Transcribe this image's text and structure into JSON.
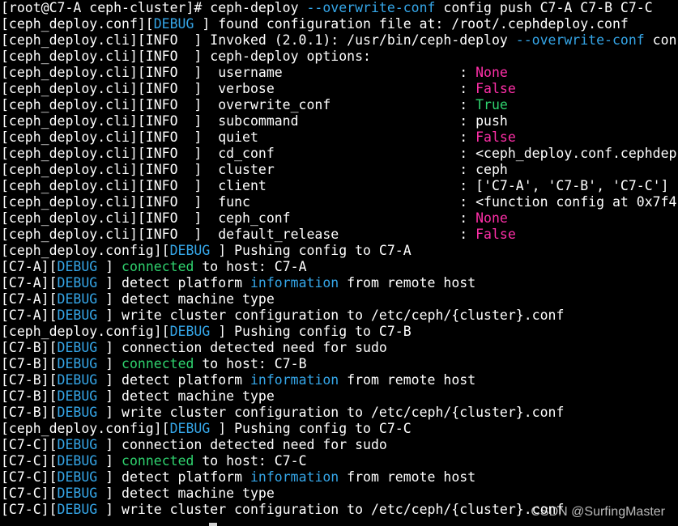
{
  "colors": {
    "default": "#ffffff",
    "debug": "#35a6e8",
    "info": "#ffffff",
    "option": "#35a6e8",
    "connected": "#2fd26e",
    "information": "#35a6e8",
    "none": "#ff2fa8",
    "false": "#ff2fa8",
    "true": "#2fd26e"
  },
  "terminal": {
    "lines": [
      [
        {
          "t": "[root@C7-A ceph-cluster]# ceph-deploy "
        },
        {
          "t": "--overwrite-conf",
          "c": "option"
        },
        {
          "t": " config push C7-A C7-B C7-C"
        }
      ],
      [
        {
          "t": "[ceph_deploy.conf]["
        },
        {
          "t": "DEBUG",
          "c": "debug"
        },
        {
          "t": " ] found configuration file at: /root/.cephdeploy.conf"
        }
      ],
      [
        {
          "t": "[ceph_deploy.cli][INFO  ] Invoked (2.0.1): /usr/bin/ceph-deploy "
        },
        {
          "t": "--overwrite-conf",
          "c": "option"
        },
        {
          "t": " con"
        }
      ],
      [
        {
          "t": "[ceph_deploy.cli][INFO  ] ceph-deploy options:"
        }
      ],
      [
        {
          "t": "[ceph_deploy.cli][INFO  ]  username                      : "
        },
        {
          "t": "None",
          "c": "none"
        }
      ],
      [
        {
          "t": "[ceph_deploy.cli][INFO  ]  verbose                       : "
        },
        {
          "t": "False",
          "c": "false"
        }
      ],
      [
        {
          "t": "[ceph_deploy.cli][INFO  ]  overwrite_conf                : "
        },
        {
          "t": "True",
          "c": "true"
        }
      ],
      [
        {
          "t": "[ceph_deploy.cli][INFO  ]  subcommand                    : push"
        }
      ],
      [
        {
          "t": "[ceph_deploy.cli][INFO  ]  quiet                         : "
        },
        {
          "t": "False",
          "c": "false"
        }
      ],
      [
        {
          "t": "[ceph_deploy.cli][INFO  ]  cd_conf                       : <ceph_deploy.conf.cephdep"
        }
      ],
      [
        {
          "t": "[ceph_deploy.cli][INFO  ]  cluster                       : ceph"
        }
      ],
      [
        {
          "t": "[ceph_deploy.cli][INFO  ]  client                        : ['C7-A', 'C7-B', 'C7-C']"
        }
      ],
      [
        {
          "t": "[ceph_deploy.cli][INFO  ]  func                          : <function config at 0x7f4"
        }
      ],
      [
        {
          "t": "[ceph_deploy.cli][INFO  ]  ceph_conf                     : "
        },
        {
          "t": "None",
          "c": "none"
        }
      ],
      [
        {
          "t": "[ceph_deploy.cli][INFO  ]  default_release               : "
        },
        {
          "t": "False",
          "c": "false"
        }
      ],
      [
        {
          "t": "[ceph_deploy.config]["
        },
        {
          "t": "DEBUG",
          "c": "debug"
        },
        {
          "t": " ] Pushing config to C7-A"
        }
      ],
      [
        {
          "t": "[C7-A]["
        },
        {
          "t": "DEBUG",
          "c": "debug"
        },
        {
          "t": " ] "
        },
        {
          "t": "connected",
          "c": "connected"
        },
        {
          "t": " to host: C7-A"
        }
      ],
      [
        {
          "t": "[C7-A]["
        },
        {
          "t": "DEBUG",
          "c": "debug"
        },
        {
          "t": " ] detect platform "
        },
        {
          "t": "information",
          "c": "information"
        },
        {
          "t": " from remote host"
        }
      ],
      [
        {
          "t": "[C7-A]["
        },
        {
          "t": "DEBUG",
          "c": "debug"
        },
        {
          "t": " ] detect machine type"
        }
      ],
      [
        {
          "t": "[C7-A]["
        },
        {
          "t": "DEBUG",
          "c": "debug"
        },
        {
          "t": " ] write cluster configuration to /etc/ceph/{cluster}.conf"
        }
      ],
      [
        {
          "t": "[ceph_deploy.config]["
        },
        {
          "t": "DEBUG",
          "c": "debug"
        },
        {
          "t": " ] Pushing config to C7-B"
        }
      ],
      [
        {
          "t": "[C7-B]["
        },
        {
          "t": "DEBUG",
          "c": "debug"
        },
        {
          "t": " ] connection detected need for sudo"
        }
      ],
      [
        {
          "t": "[C7-B]["
        },
        {
          "t": "DEBUG",
          "c": "debug"
        },
        {
          "t": " ] "
        },
        {
          "t": "connected",
          "c": "connected"
        },
        {
          "t": " to host: C7-B"
        }
      ],
      [
        {
          "t": "[C7-B]["
        },
        {
          "t": "DEBUG",
          "c": "debug"
        },
        {
          "t": " ] detect platform "
        },
        {
          "t": "information",
          "c": "information"
        },
        {
          "t": " from remote host"
        }
      ],
      [
        {
          "t": "[C7-B]["
        },
        {
          "t": "DEBUG",
          "c": "debug"
        },
        {
          "t": " ] detect machine type"
        }
      ],
      [
        {
          "t": "[C7-B]["
        },
        {
          "t": "DEBUG",
          "c": "debug"
        },
        {
          "t": " ] write cluster configuration to /etc/ceph/{cluster}.conf"
        }
      ],
      [
        {
          "t": "[ceph_deploy.config]["
        },
        {
          "t": "DEBUG",
          "c": "debug"
        },
        {
          "t": " ] Pushing config to C7-C"
        }
      ],
      [
        {
          "t": "[C7-C]["
        },
        {
          "t": "DEBUG",
          "c": "debug"
        },
        {
          "t": " ] connection detected need for sudo"
        }
      ],
      [
        {
          "t": "[C7-C]["
        },
        {
          "t": "DEBUG",
          "c": "debug"
        },
        {
          "t": " ] "
        },
        {
          "t": "connected",
          "c": "connected"
        },
        {
          "t": " to host: C7-C"
        }
      ],
      [
        {
          "t": "[C7-C]["
        },
        {
          "t": "DEBUG",
          "c": "debug"
        },
        {
          "t": " ] detect platform "
        },
        {
          "t": "information",
          "c": "information"
        },
        {
          "t": " from remote host"
        }
      ],
      [
        {
          "t": "[C7-C]["
        },
        {
          "t": "DEBUG",
          "c": "debug"
        },
        {
          "t": " ] detect machine type"
        }
      ],
      [
        {
          "t": "[C7-C]["
        },
        {
          "t": "DEBUG",
          "c": "debug"
        },
        {
          "t": " ] write cluster configuration to /etc/ceph/{cluster}.conf"
        }
      ]
    ]
  },
  "watermark": {
    "text": "CSDN @SurfingMaster"
  }
}
